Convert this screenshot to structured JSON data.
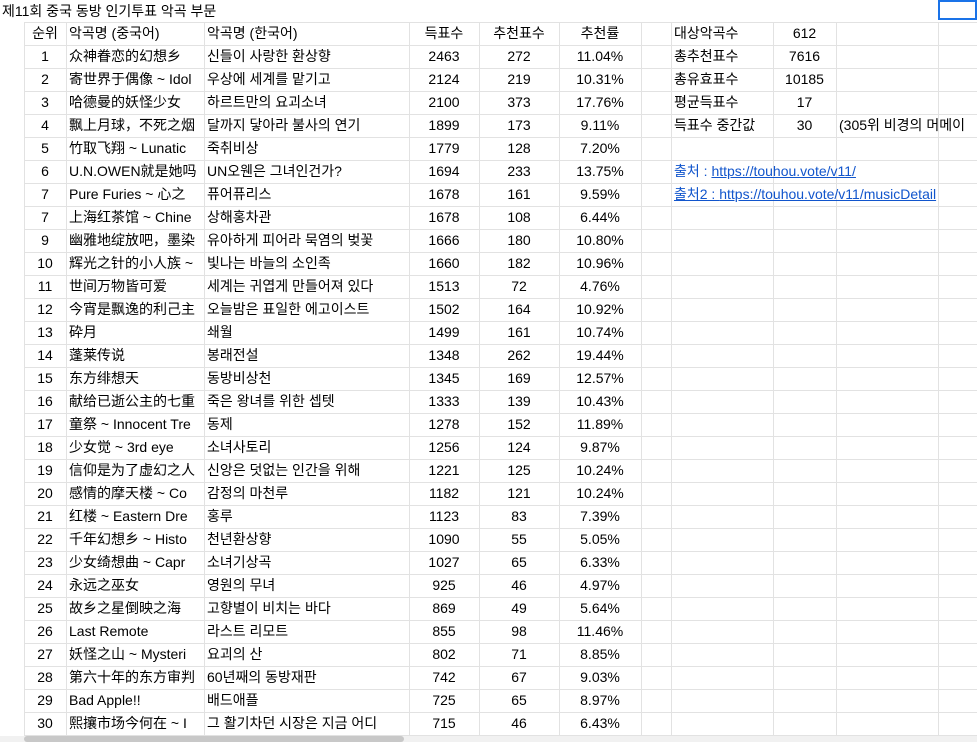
{
  "title": "제11회 중국 동방 인기투표 악곡 부문",
  "headers": [
    "순위",
    "악곡명 (중국어)",
    "악곡명 (한국어)",
    "득표수",
    "추천표수",
    "추천률"
  ],
  "rows": [
    [
      "1",
      "众神眷恋的幻想乡",
      "신들이 사랑한 환상향",
      "2463",
      "272",
      "11.04%"
    ],
    [
      "2",
      "寄世界于偶像 ~ Idol",
      "우상에 세계를 맡기고",
      "2124",
      "219",
      "10.31%"
    ],
    [
      "3",
      "哈德曼的妖怪少女",
      "하르트만의 요괴소녀",
      "2100",
      "373",
      "17.76%"
    ],
    [
      "4",
      "飘上月球，不死之烟",
      "달까지 닿아라 불사의 연기",
      "1899",
      "173",
      "9.11%"
    ],
    [
      "5",
      "竹取飞翔 ~ Lunatic",
      "죽취비상",
      "1779",
      "128",
      "7.20%"
    ],
    [
      "6",
      "U.N.OWEN就是她吗",
      "UN오웬은 그녀인건가?",
      "1694",
      "233",
      "13.75%"
    ],
    [
      "7",
      "Pure Furies ~ 心之",
      "퓨어퓨리스",
      "1678",
      "161",
      "9.59%"
    ],
    [
      "7",
      "上海红茶馆 ~ Chine",
      "상해홍차관",
      "1678",
      "108",
      "6.44%"
    ],
    [
      "9",
      "幽雅地绽放吧，墨染",
      "유아하게 피어라 묵염의 벚꽃",
      "1666",
      "180",
      "10.80%"
    ],
    [
      "10",
      "辉光之针的小人族 ~",
      "빛나는 바늘의 소인족",
      "1660",
      "182",
      "10.96%"
    ],
    [
      "11",
      "世间万物皆可爱",
      "세계는 귀엽게 만들어져 있다",
      "1513",
      "72",
      "4.76%"
    ],
    [
      "12",
      "今宵是飘逸的利己主",
      "오늘밤은 표일한 에고이스트",
      "1502",
      "164",
      "10.92%"
    ],
    [
      "13",
      "砕月",
      "쇄월",
      "1499",
      "161",
      "10.74%"
    ],
    [
      "14",
      "蓬莱传说",
      "봉래전설",
      "1348",
      "262",
      "19.44%"
    ],
    [
      "15",
      "东方绯想天",
      "동방비상천",
      "1345",
      "169",
      "12.57%"
    ],
    [
      "16",
      "献给已逝公主的七重",
      "죽은 왕녀를 위한 셉텟",
      "1333",
      "139",
      "10.43%"
    ],
    [
      "17",
      "童祭 ~ Innocent Tre",
      "동제",
      "1278",
      "152",
      "11.89%"
    ],
    [
      "18",
      "少女觉 ~ 3rd eye",
      "소녀사토리",
      "1256",
      "124",
      "9.87%"
    ],
    [
      "19",
      "信仰是为了虚幻之人",
      "신앙은 덧없는 인간을 위해",
      "1221",
      "125",
      "10.24%"
    ],
    [
      "20",
      "感情的摩天楼 ~ Co",
      "감정의 마천루",
      "1182",
      "121",
      "10.24%"
    ],
    [
      "21",
      "红楼 ~ Eastern Dre",
      "홍루",
      "1123",
      "83",
      "7.39%"
    ],
    [
      "22",
      "千年幻想乡 ~ Histo",
      "천년환상향",
      "1090",
      "55",
      "5.05%"
    ],
    [
      "23",
      "少女绮想曲 ~ Capr",
      "소녀기상곡",
      "1027",
      "65",
      "6.33%"
    ],
    [
      "24",
      "永远之巫女",
      "영원의 무녀",
      "925",
      "46",
      "4.97%"
    ],
    [
      "25",
      "故乡之星倒映之海",
      "고향별이 비치는 바다",
      "869",
      "49",
      "5.64%"
    ],
    [
      "26",
      "Last Remote",
      "라스트 리모트",
      "855",
      "98",
      "11.46%"
    ],
    [
      "27",
      "妖怪之山 ~ Mysteri",
      "요괴의 산",
      "802",
      "71",
      "8.85%"
    ],
    [
      "28",
      "第六十年的东方审判",
      "60년째의 동방재판",
      "742",
      "67",
      "9.03%"
    ],
    [
      "29",
      "Bad Apple!!",
      "배드애플",
      "725",
      "65",
      "8.97%"
    ],
    [
      "30",
      "熙攘市场今何在 ~ I",
      "그 활기차던 시장은 지금 어디",
      "715",
      "46",
      "6.43%"
    ]
  ],
  "stats": [
    {
      "label": "대상악곡수",
      "value": "612",
      "note": ""
    },
    {
      "label": "총추천표수",
      "value": "7616",
      "note": ""
    },
    {
      "label": "총유효표수",
      "value": "10185",
      "note": ""
    },
    {
      "label": "평균득표수",
      "value": "17",
      "note": ""
    },
    {
      "label": "득표수 중간값",
      "value": "30",
      "note": "(305위 비경의 머메이"
    }
  ],
  "sources": [
    {
      "prefix": "출처 : ",
      "url": "https://touhou.vote/v11/"
    },
    {
      "prefix": "출처2 : ",
      "url": "https://touhou.vote/v11/musicDetail"
    }
  ]
}
